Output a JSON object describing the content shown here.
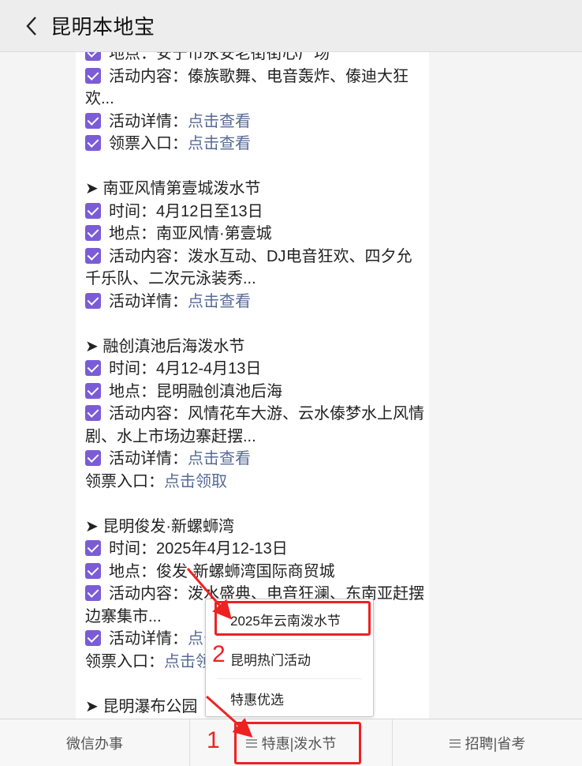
{
  "header": {
    "title": "昆明本地宝"
  },
  "content": {
    "lines": [
      {
        "type": "check",
        "text": "地点：安宁市永安老街街心广场"
      },
      {
        "type": "check",
        "text": "活动内容：傣族歌舞、电音轰炸、傣迪大狂欢..."
      },
      {
        "type": "check",
        "text": "活动详情：",
        "link": "点击查看"
      },
      {
        "type": "check",
        "text": "领票入口：",
        "link": "点击查看"
      },
      {
        "type": "gap"
      },
      {
        "type": "heading",
        "text": "➤ 南亚风情第壹城泼水节"
      },
      {
        "type": "check",
        "text": "时间：4月12日至13日"
      },
      {
        "type": "check",
        "text": "地点：南亚风情·第壹城"
      },
      {
        "type": "check",
        "text": "活动内容：泼水互动、DJ电音狂欢、四夕允千乐队、二次元泳装秀..."
      },
      {
        "type": "check",
        "text": "活动详情：",
        "link": "点击查看"
      },
      {
        "type": "gap"
      },
      {
        "type": "heading",
        "text": "➤ 融创滇池后海泼水节"
      },
      {
        "type": "check",
        "text": "时间：4月12-4月13日"
      },
      {
        "type": "check",
        "text": "地点：昆明融创滇池后海"
      },
      {
        "type": "check",
        "text": "活动内容：风情花车大游、云水傣梦水上风情剧、水上市场边寨赶摆..."
      },
      {
        "type": "check",
        "text": "活动详情：",
        "link": "点击查看"
      },
      {
        "type": "plain",
        "text": "领票入口：",
        "link": "点击领取"
      },
      {
        "type": "gap"
      },
      {
        "type": "heading",
        "text": "➤ 昆明俊发·新螺蛳湾"
      },
      {
        "type": "check",
        "text": "时间：2025年4月12-13日"
      },
      {
        "type": "check",
        "text": "地点：俊发·新螺蛳湾国际商贸城"
      },
      {
        "type": "check",
        "text": "活动内容：泼水盛典、电音狂澜、东南亚赶摆边寨集市..."
      },
      {
        "type": "check",
        "text": "活动详情：",
        "link": "点击查看"
      },
      {
        "type": "plain",
        "text": "领票入口：",
        "link": "点击领取"
      },
      {
        "type": "gap"
      },
      {
        "type": "heading",
        "text": "➤ 昆明瀑布公园"
      }
    ]
  },
  "popup_menu": {
    "items": [
      "2025年云南泼水节",
      "昆明热门活动",
      "特惠优选"
    ]
  },
  "bottom_menu": {
    "tabs": [
      {
        "label": "微信办事",
        "has_menu_icon": false
      },
      {
        "label": "特惠|泼水节",
        "has_menu_icon": true
      },
      {
        "label": "招聘|省考",
        "has_menu_icon": true
      }
    ]
  },
  "annotations": {
    "step1": "1",
    "step2": "2",
    "color": "#ee2222"
  },
  "colors": {
    "checkbox": "#7b5cd6",
    "link": "#576b95",
    "header_bg": "#ededed"
  }
}
